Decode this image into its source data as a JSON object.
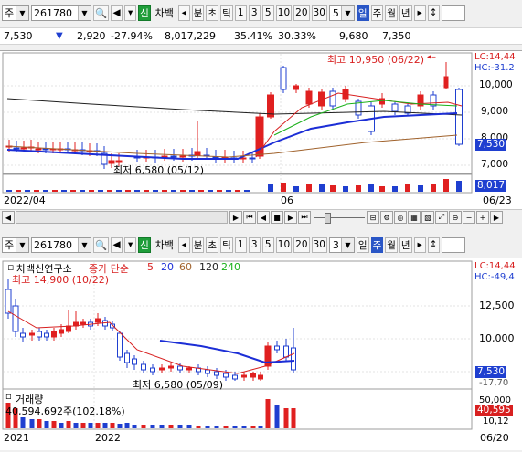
{
  "top": {
    "toolbar": {
      "market": "주",
      "code": "261780",
      "new_label": "신",
      "name_label": "차백",
      "minute_label": "분",
      "tick_label": "초",
      "tick2_label": "틱",
      "intervals": [
        "1",
        "3",
        "5",
        "10",
        "20",
        "30"
      ],
      "period_value": "5",
      "day_label": "일",
      "week_label": "주",
      "month_label": "월",
      "year_label": "년"
    },
    "quote": {
      "price": "7,530",
      "change": "2,920",
      "change_pct": "-27.94%",
      "volume": "8,017,229",
      "pct1": "35.41%",
      "pct2": "30.33%",
      "val1": "9,680",
      "val2": "7,350"
    },
    "chart": {
      "high_annotation": "최고 10,950 (06/22)",
      "low_annotation": "최저 6,580 (05/12)",
      "lc_label": "LC:14,44",
      "hc_label": "HC:-31.2",
      "y_ticks": [
        "10,000",
        "9,000",
        "8,000",
        "7,000"
      ],
      "current_price_tag": "7,530",
      "volume_tag": "8,017",
      "x_labels": [
        "2022/04",
        "06",
        "06/23"
      ]
    }
  },
  "bottom": {
    "toolbar": {
      "market": "주",
      "code": "261780",
      "new_label": "신",
      "name_label": "차백",
      "minute_label": "분",
      "tick_label": "초",
      "tick2_label": "틱",
      "intervals": [
        "1",
        "3",
        "5",
        "10",
        "20",
        "30"
      ],
      "period_value": "3",
      "day_label": "일",
      "week_label": "주",
      "month_label": "월",
      "year_label": "년"
    },
    "chart": {
      "legend_title": "차백신연구소",
      "legend_ma": "종가 단순",
      "ma_periods": [
        "5",
        "20",
        "60",
        "120",
        "240"
      ],
      "high_annotation": "최고 14,900 (10/22)",
      "low_annotation": "최저 6,580 (05/09)",
      "lc_label": "LC:14,44",
      "hc_label": "HC:-49,4",
      "y_ticks": [
        "12,500",
        "10,000"
      ],
      "current_price_tag": "7,530",
      "hc_pct_tag": "-17,70",
      "volume_title": "거래량",
      "volume_value": "40,594,692주(102.18%)",
      "volume_tag": "40,595",
      "vol_tick_top": "50,000",
      "vol_tick_bot": "10,12",
      "x_labels": [
        "2021",
        "2022",
        "06/20"
      ]
    }
  },
  "colors": {
    "up": "#e02020",
    "down": "#1f3fd0",
    "ma_blue": "#1c2ed6",
    "ma_red": "#d82020",
    "ma_green": "#19b019",
    "ma_brown": "#a0622c",
    "ma_black": "#202020",
    "select_blue": "#2a56c6"
  }
}
